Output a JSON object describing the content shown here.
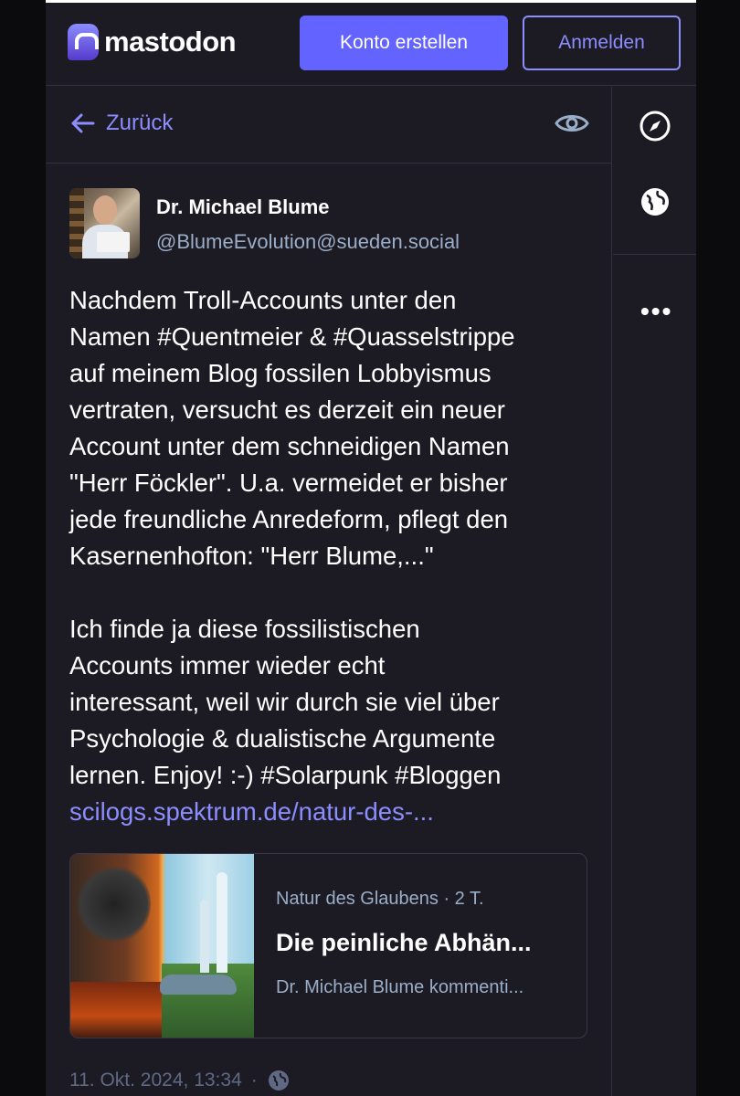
{
  "header": {
    "logo_text": "mastodon",
    "create_account_label": "Konto erstellen",
    "login_label": "Anmelden"
  },
  "back_bar": {
    "back_label": "Zurück"
  },
  "status": {
    "display_name": "Dr. Michael Blume",
    "account": "@BlumeEvolution@sueden.social",
    "paragraph_1": "Nachdem Troll-Accounts unter den\nNamen #Quentmeier & #Quasselstrippe\nauf meinem Blog fossilen Lobbyismus\nvertraten, versucht es derzeit ein neuer\nAccount unter dem schneidigen Namen\n\"Herr Föckler\". U.a. vermeidet er bisher\njede freundliche Anredeform, pflegt den\nKasernenhofton: \"Herr Blume,...\"",
    "paragraph_2": "Ich finde ja diese fossilistischen\nAccounts immer wieder echt\ninteressant, weil wir durch sie viel über\nPsychologie & dualistische Argumente\nlernen. Enjoy! :-) #Solarpunk #Bloggen",
    "link_text": "scilogs.spektrum.de/natur-des-...",
    "timestamp": "11. Okt. 2024, 13:34",
    "separator": "·"
  },
  "preview_card": {
    "source": "Natur des Glaubens · 2 T.",
    "title": "Die peinliche Abhän...",
    "description": "Dr. Michael Blume kommenti..."
  },
  "colors": {
    "accent": "#6364ff",
    "link": "#8c8dff",
    "muted": "#9baec8",
    "background": "#1c1b24"
  },
  "icons": {
    "back": "arrow-left-icon",
    "visibility": "eye-icon",
    "explore": "compass-icon",
    "public": "globe-icon",
    "more": "ellipsis-icon"
  }
}
